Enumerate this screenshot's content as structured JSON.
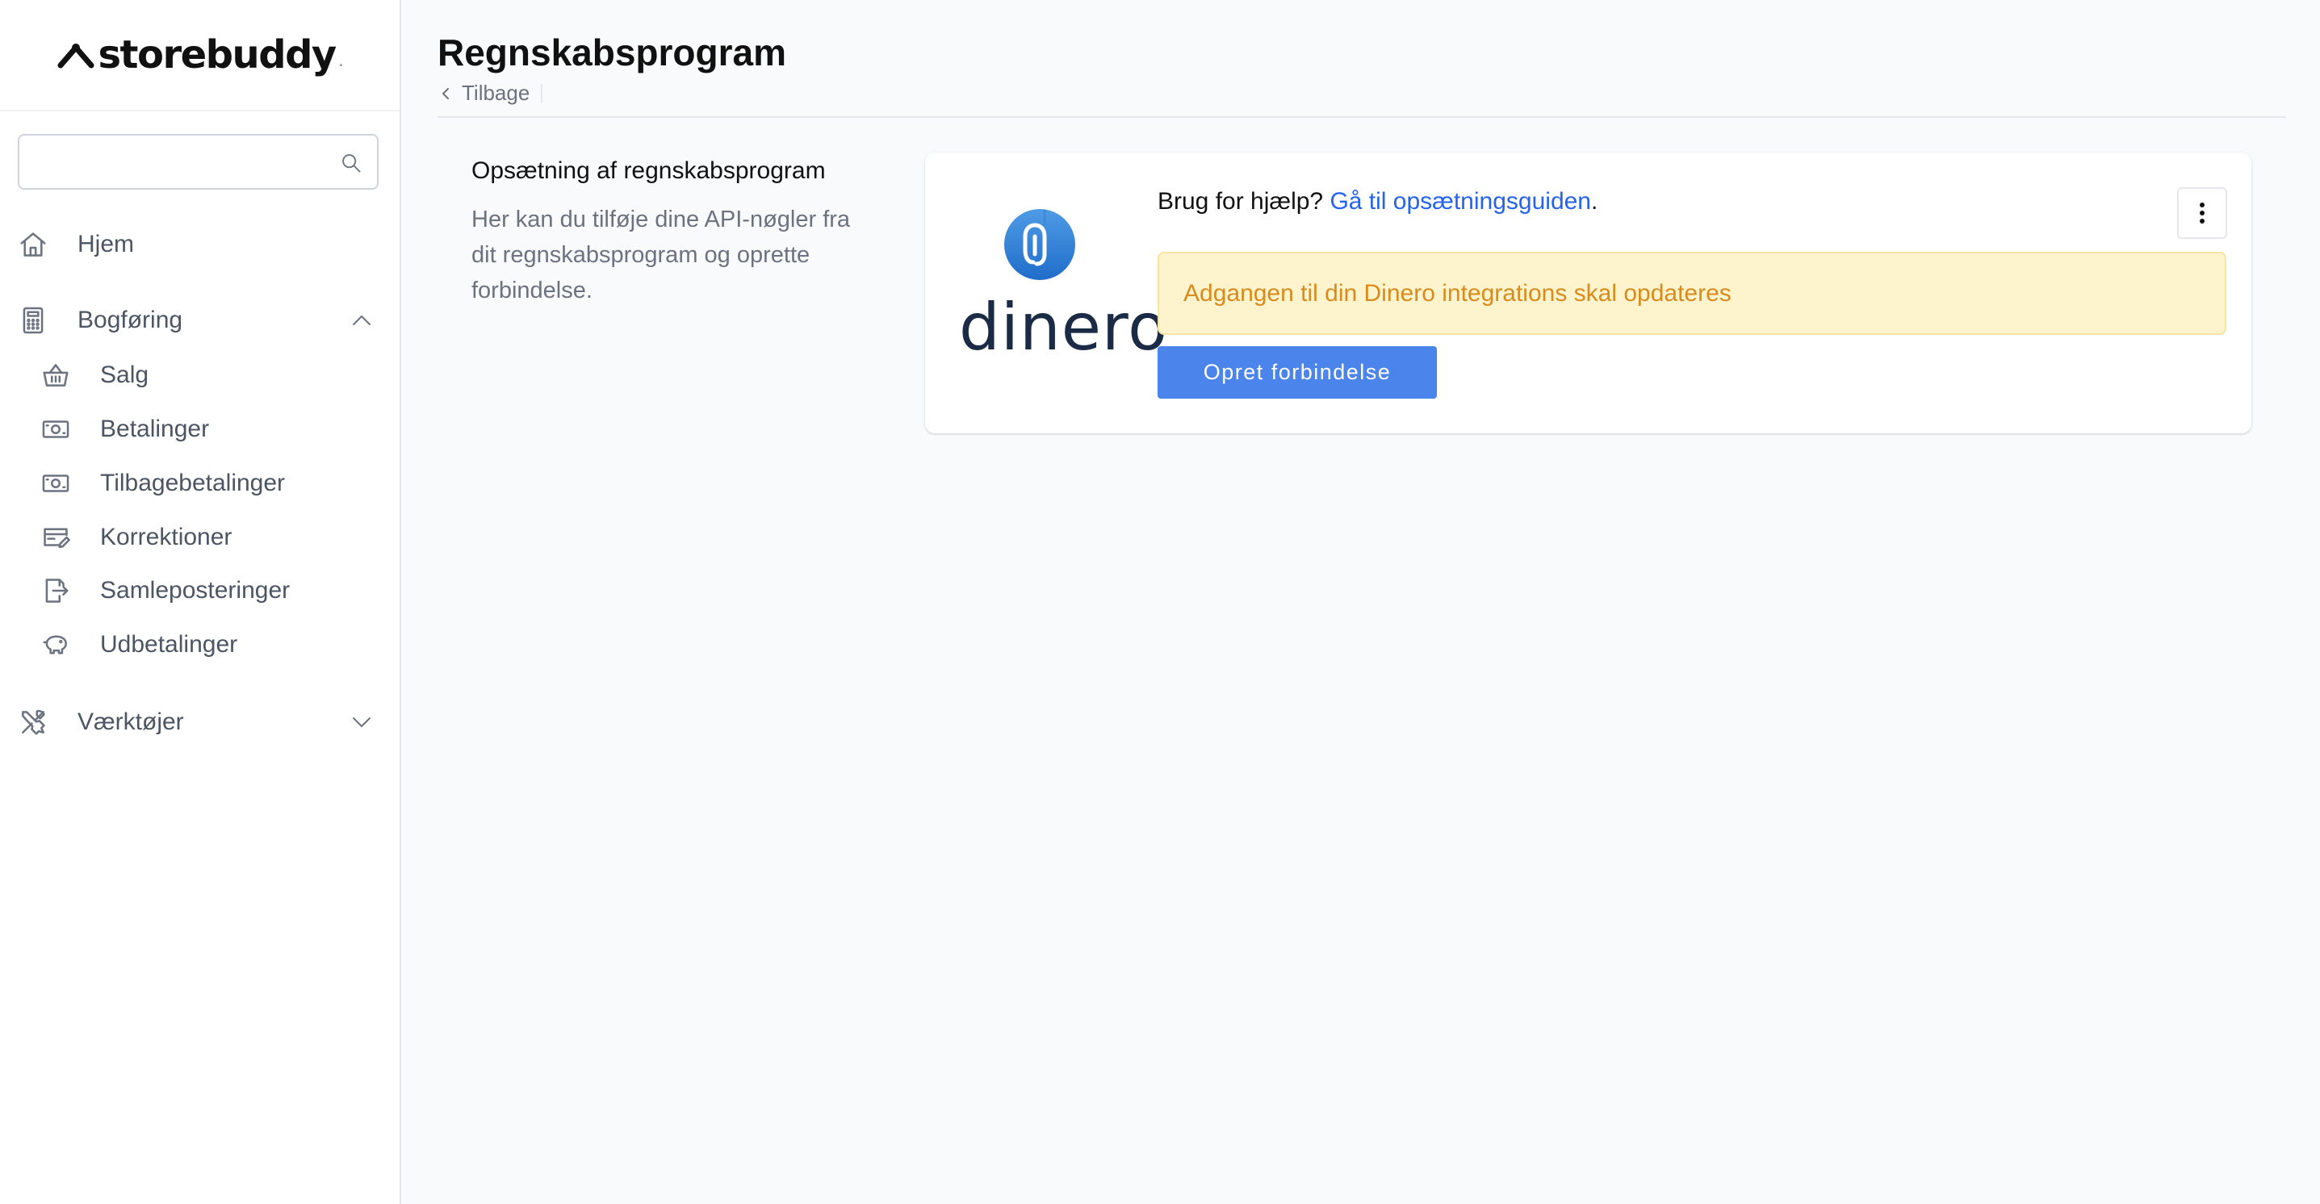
{
  "app": {
    "logo_text": "storebuddy",
    "logo_mark": "."
  },
  "sidebar": {
    "search": {
      "placeholder": "",
      "icon": "search-icon"
    },
    "items": [
      {
        "label": "Hjem",
        "icon": "home-icon"
      },
      {
        "label": "Bogføring",
        "icon": "calculator-icon",
        "expanded": true
      },
      {
        "label": "Værktøjer",
        "icon": "tools-icon",
        "expanded": false
      }
    ],
    "sub_items": [
      {
        "label": "Salg",
        "icon": "basket-icon"
      },
      {
        "label": "Betalinger",
        "icon": "cash-icon"
      },
      {
        "label": "Tilbagebetalinger",
        "icon": "cash-return-icon"
      },
      {
        "label": "Korrektioner",
        "icon": "edit-card-icon"
      },
      {
        "label": "Samleposteringer",
        "icon": "document-export-icon"
      },
      {
        "label": "Udbetalinger",
        "icon": "piggy-bank-icon"
      }
    ]
  },
  "header": {
    "title": "Regnskabsprogram",
    "back_label": "Tilbage"
  },
  "intro": {
    "title": "Opsætning af regnskabsprogram",
    "description": "Her kan du tilføje dine API-nøgler fra dit regnskabsprogram og oprette forbindelse."
  },
  "card": {
    "brand": "dinero",
    "help_prefix": "Brug for hjælp?",
    "help_link": "Gå til opsætningsguiden",
    "help_suffix": ".",
    "alert": "Adgangen til din Dinero integrations skal opdateres",
    "button": "Opret forbindelse"
  },
  "colors": {
    "accent": "#4b84ea",
    "link": "#2563eb",
    "alert_bg": "#fdf3cd",
    "alert_text": "#d98b1c",
    "brand_dark": "#1b2b45"
  }
}
